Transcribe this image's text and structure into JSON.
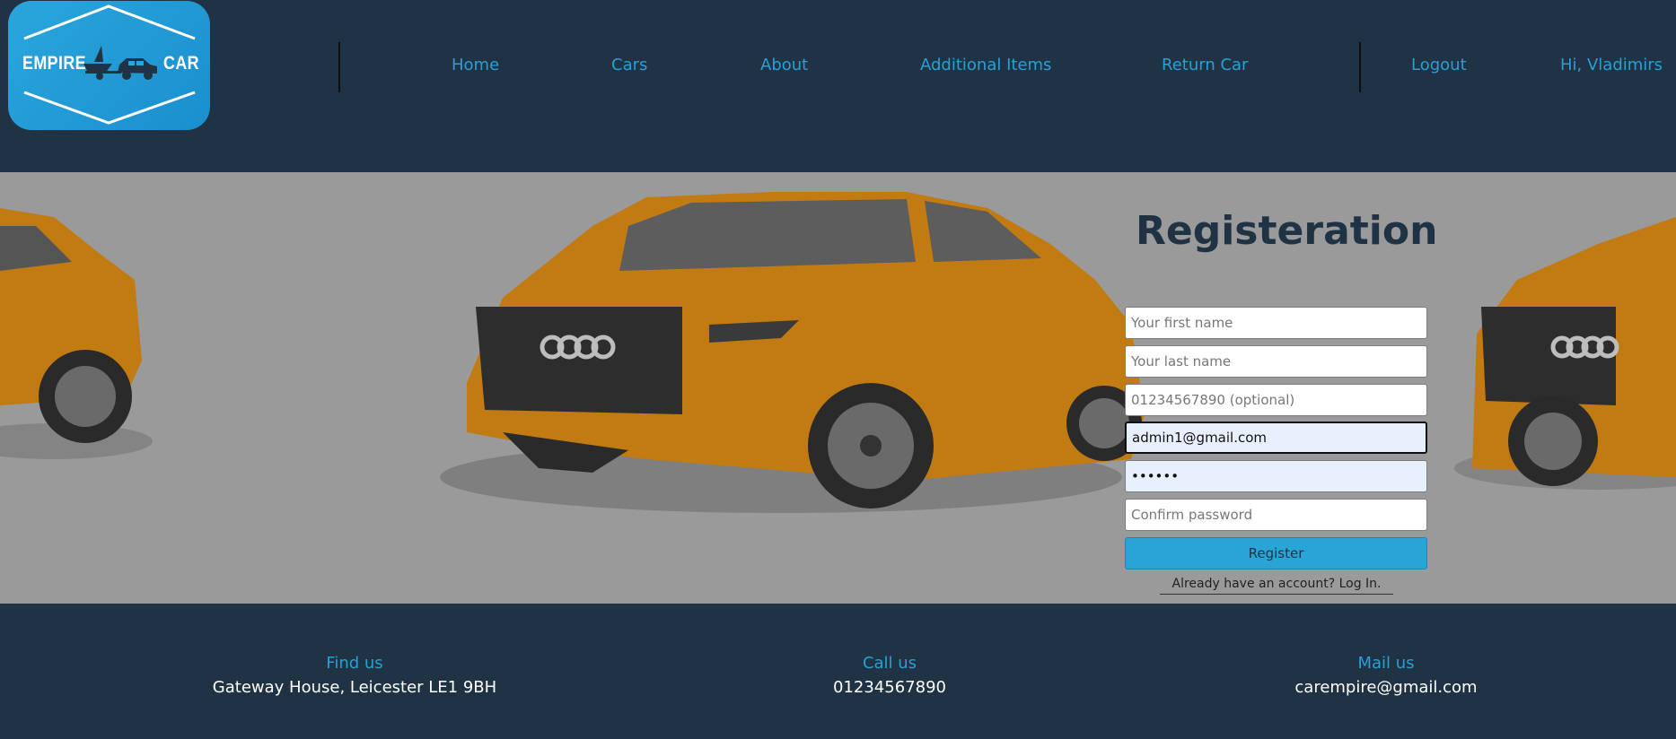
{
  "brand": {
    "left_word": "EMPIRE",
    "right_word": "CAR"
  },
  "nav": {
    "items": [
      {
        "label": "Home"
      },
      {
        "label": "Cars"
      },
      {
        "label": "About"
      },
      {
        "label": "Additional Items"
      },
      {
        "label": "Return Car"
      }
    ],
    "logout": "Logout",
    "greeting": "Hi, Vladimirs"
  },
  "form": {
    "title": "Registeration",
    "first_name_placeholder": "Your first name",
    "last_name_placeholder": "Your last name",
    "phone_placeholder": "01234567890 (optional)",
    "email_value": "admin1@gmail.com",
    "password_value": "••••••",
    "confirm_placeholder": "Confirm password",
    "register_label": "Register",
    "login_link": "Already have an account? Log In."
  },
  "footer": {
    "find": {
      "heading": "Find us",
      "value": "Gateway House, Leicester LE1 9BH"
    },
    "call": {
      "heading": "Call us",
      "value": "01234567890"
    },
    "mail": {
      "heading": "Mail us",
      "value": "carempire@gmail.com"
    }
  },
  "colors": {
    "navy": "#1f3344",
    "accent": "#2a9fd6",
    "hero_bg": "#9a9a9a",
    "car_orange": "#c27a12"
  },
  "icons": [
    "car-with-trailer-logo-icon"
  ]
}
